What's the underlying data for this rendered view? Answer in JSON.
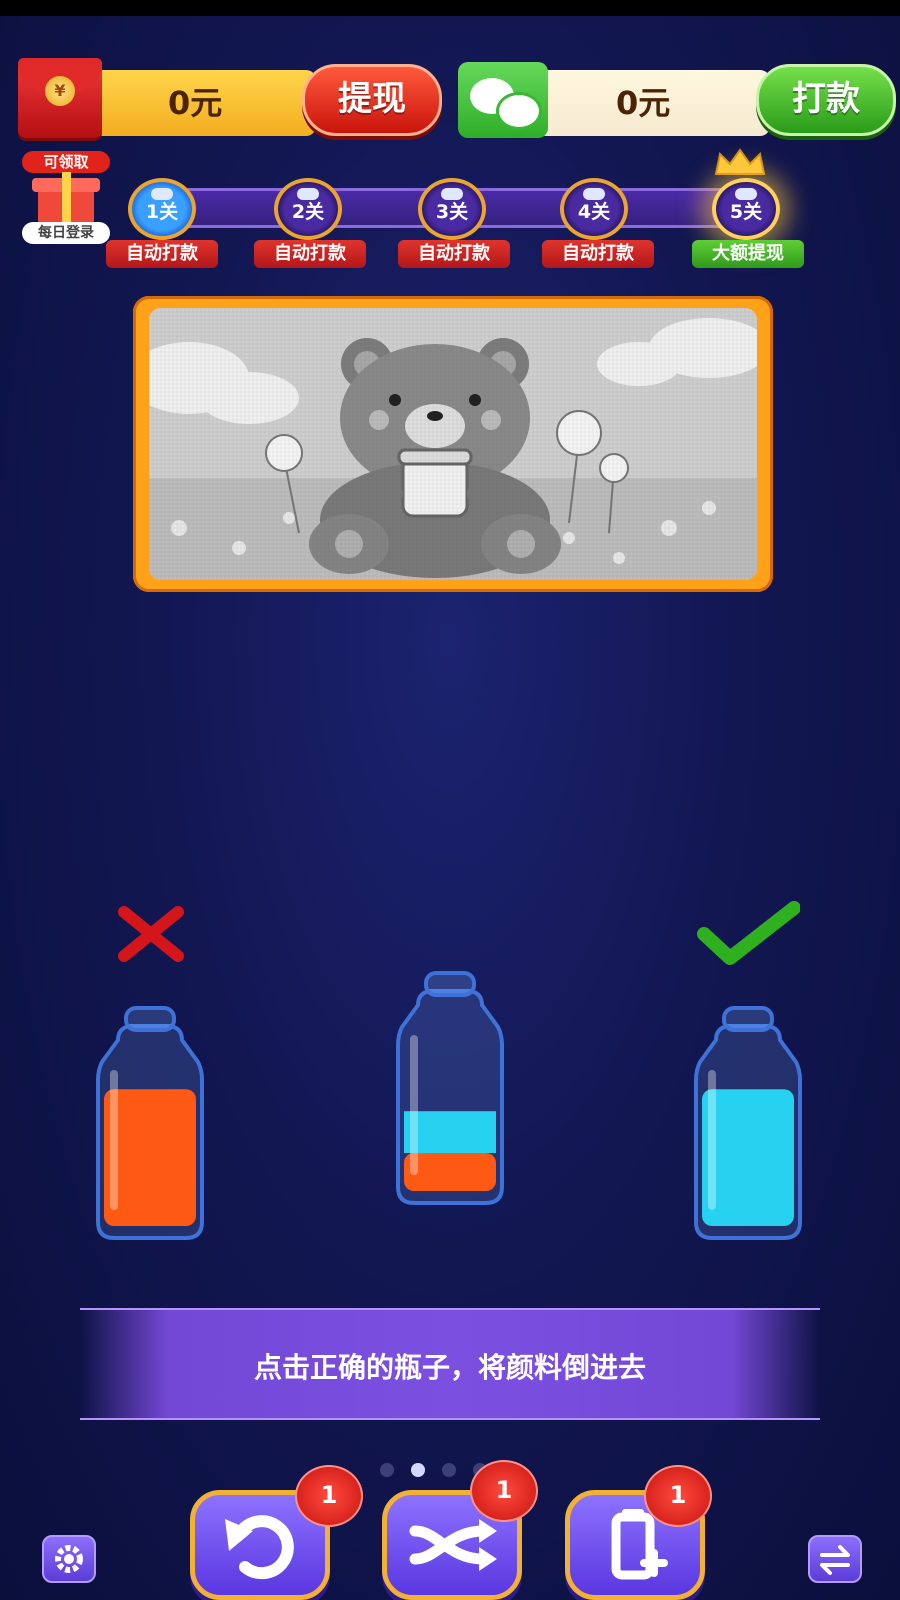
{
  "wallet": {
    "redpacket_amount": "0元",
    "withdraw_label": "提现",
    "wechat_amount": "0元",
    "pay_label": "打款"
  },
  "daily_gift": {
    "tag": "可领取",
    "label": "每日登录"
  },
  "levels": [
    {
      "label": "1关",
      "reward": "自动打款",
      "status": "current"
    },
    {
      "label": "2关",
      "reward": "自动打款",
      "status": "locked"
    },
    {
      "label": "3关",
      "reward": "自动打款",
      "status": "locked"
    },
    {
      "label": "4关",
      "reward": "自动打款",
      "status": "locked"
    },
    {
      "label": "5关",
      "reward": "大额提现",
      "status": "grand"
    }
  ],
  "puzzle_image": "bear-with-honey-jar-grayscale",
  "bottles": [
    {
      "name": "left-bottle",
      "fill": [
        {
          "color": "#ff5a14",
          "level": 0.72
        }
      ],
      "verdict": "wrong"
    },
    {
      "name": "middle-bottle",
      "fill": [
        {
          "color": "#ff5a14",
          "level": 0.2
        },
        {
          "color": "#26d2f0",
          "level": 0.22
        }
      ],
      "verdict": "none"
    },
    {
      "name": "right-bottle",
      "fill": [
        {
          "color": "#26d2f0",
          "level": 0.72
        }
      ],
      "verdict": "correct"
    }
  ],
  "instruction": "点击正确的瓶子，将颜料倒进去",
  "pager": {
    "count": 5,
    "active": 1
  },
  "tools": [
    {
      "name": "undo",
      "icon": "undo-icon",
      "count": "1"
    },
    {
      "name": "shuffle",
      "icon": "shuffle-icon",
      "count": "1"
    },
    {
      "name": "add-bottle",
      "icon": "add-bottle-icon",
      "count": "1"
    }
  ],
  "colors": {
    "accent": "#7b4fe0",
    "gold": "#ffa21a",
    "red": "#e0342c",
    "green": "#3fb02a"
  }
}
